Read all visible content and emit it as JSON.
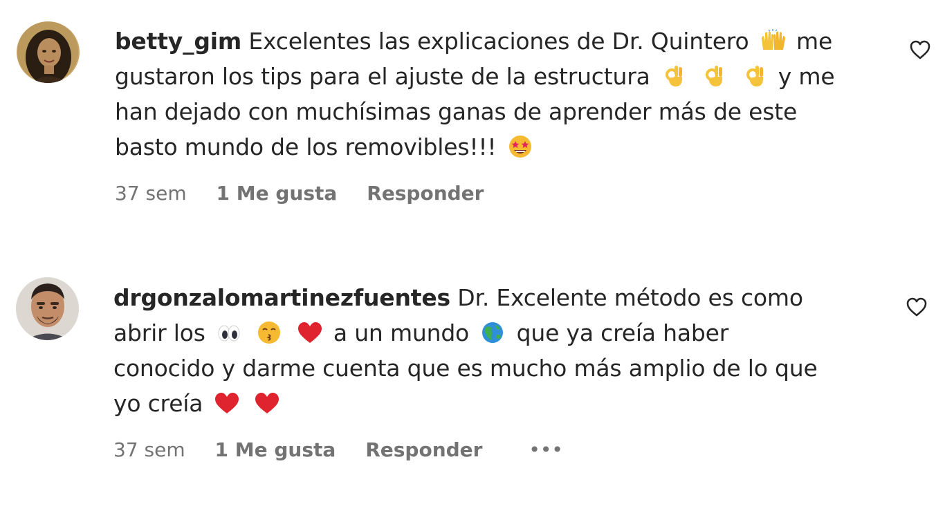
{
  "comments": [
    {
      "username": "betty_gim",
      "lines": [
        {
          "segments": [
            {
              "t": "Excelentes las explicaciones de Dr. Quintero"
            },
            {
              "emoji": "raising-hands"
            },
            {
              "t": "me"
            }
          ]
        },
        {
          "segments": [
            {
              "t": "gustaron los tips para el ajuste de la estructura"
            },
            {
              "emoji": "ok-hand"
            },
            {
              "emoji": "ok-hand"
            },
            {
              "emoji": "ok-hand"
            },
            {
              "t": "y me"
            }
          ]
        },
        {
          "segments": [
            {
              "t": "han dejado con muchísimas ganas de aprender más de este"
            }
          ]
        },
        {
          "segments": [
            {
              "t": "basto mundo de los removibles!!!"
            },
            {
              "emoji": "star-struck"
            }
          ]
        }
      ],
      "time": "37 sem",
      "likes": "1 Me gusta",
      "reply_label": "Responder",
      "like_icon": "heart-outline-icon"
    },
    {
      "username": "drgonzalomartinezfuentes",
      "lines": [
        {
          "segments": [
            {
              "t": "Dr. Excelente método es como"
            }
          ]
        },
        {
          "segments": [
            {
              "t": "abrir los"
            },
            {
              "emoji": "eyes"
            },
            {
              "emoji": "kissing-face"
            },
            {
              "emoji": "red-heart"
            },
            {
              "t": "a un mundo"
            },
            {
              "emoji": "globe"
            },
            {
              "t": "que ya creía haber"
            }
          ]
        },
        {
          "segments": [
            {
              "t": "conocido y darme cuenta que es mucho más amplio de lo que"
            }
          ]
        },
        {
          "segments": [
            {
              "t": "yo creía"
            },
            {
              "emoji": "red-heart"
            },
            {
              "emoji": "red-heart"
            }
          ]
        }
      ],
      "time": "37 sem",
      "likes": "1 Me gusta",
      "reply_label": "Responder",
      "more_label": "•••",
      "like_icon": "heart-outline-icon"
    }
  ],
  "colors": {
    "text": "#262626",
    "secondary": "#737373",
    "heart_red": "#e0242f",
    "emoji_yellow": "#f5c33b"
  }
}
